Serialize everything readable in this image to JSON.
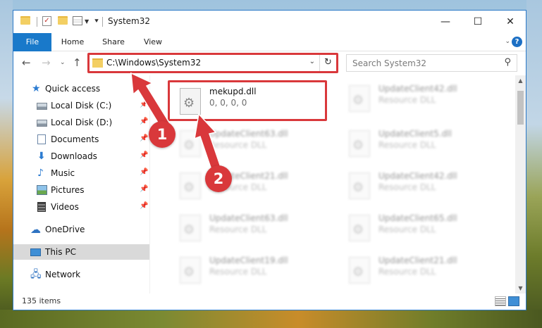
{
  "window": {
    "title": "System32"
  },
  "ribbon": {
    "tabs": [
      "File",
      "Home",
      "Share",
      "View"
    ]
  },
  "titlebar": {
    "minimize": "—",
    "maximize": "☐",
    "close": "✕"
  },
  "address": {
    "path": "C:\\Windows\\System32"
  },
  "search": {
    "placeholder": "Search System32"
  },
  "nav": {
    "quick_access": "Quick access",
    "items": [
      {
        "label": "Local Disk (C:)",
        "icon": "drive-icon",
        "pinned": true
      },
      {
        "label": "Local Disk (D:)",
        "icon": "drive-icon",
        "pinned": true
      },
      {
        "label": "Documents",
        "icon": "documents-icon",
        "pinned": true
      },
      {
        "label": "Downloads",
        "icon": "downloads-icon",
        "pinned": true
      },
      {
        "label": "Music",
        "icon": "music-icon",
        "pinned": true
      },
      {
        "label": "Pictures",
        "icon": "pictures-icon",
        "pinned": true
      },
      {
        "label": "Videos",
        "icon": "videos-icon",
        "pinned": true
      }
    ],
    "onedrive": "OneDrive",
    "this_pc": "This PC",
    "network": "Network"
  },
  "files": [
    {
      "name": "mekupd.dll",
      "desc": "0, 0, 0, 0",
      "highlighted": true
    },
    {
      "name": "UpdateClient42.dll",
      "desc": "Resource DLL"
    },
    {
      "name": "UpdateClient63.dll",
      "desc": "Resource DLL"
    },
    {
      "name": "UpdateClient5.dll",
      "desc": "Resource DLL"
    },
    {
      "name": "UpdateClient21.dll",
      "desc": "Resource DLL"
    },
    {
      "name": "UpdateClient42.dll",
      "desc": "Resource DLL"
    },
    {
      "name": "UpdateClient63.dll",
      "desc": "Resource DLL"
    },
    {
      "name": "UpdateClient65.dll",
      "desc": "Resource DLL"
    },
    {
      "name": "UpdateClient19.dll",
      "desc": "Resource DLL"
    },
    {
      "name": "UpdateClient21.dll",
      "desc": "Resource DLL"
    }
  ],
  "status": {
    "count": "135 items"
  },
  "annotations": {
    "step1": "1",
    "step2": "2",
    "color": "#d9383b"
  },
  "colors": {
    "accent": "#1979ca",
    "highlight": "#d9383b"
  }
}
